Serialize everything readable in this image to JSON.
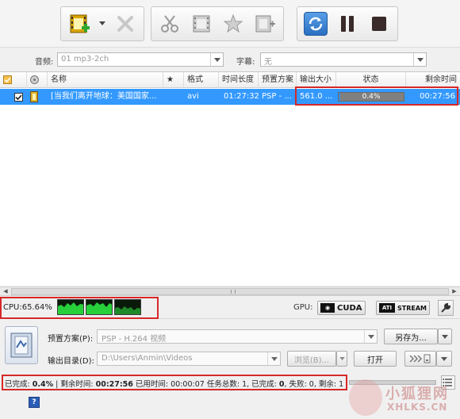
{
  "toolbar": {
    "icons": [
      "add-video-icon",
      "delete-icon",
      "cut-icon",
      "clip-icon",
      "effect-icon",
      "merge-icon",
      "convert-icon",
      "pause-icon",
      "stop-icon"
    ]
  },
  "options": {
    "audio_label": "音频:",
    "audio_value": "01 mp3-2ch",
    "subtitle_label": "字幕:",
    "subtitle_value": "无"
  },
  "columns": [
    "名称",
    "★",
    "格式",
    "时间长度",
    "预置方案",
    "输出大小",
    "状态",
    "剩余时间"
  ],
  "rows": [
    {
      "checked": true,
      "name": "[当我们离开地球：美国国家...",
      "format": "avi",
      "duration": "01:27:32",
      "preset": "PSP - ...",
      "output_size": "561.0 ...",
      "progress": 0.004,
      "progress_text": "0.4%",
      "remaining": "00:27:56"
    }
  ],
  "cpu": {
    "label": "CPU:65.64%",
    "gpu_label": "GPU:",
    "cuda": "CUDA",
    "stream": "STREAM",
    "ati": "ATI"
  },
  "settings": {
    "preset_label": "预置方案(P):",
    "preset_value": "PSP - H.264 视频",
    "save_as": "另存为...",
    "output_label": "输出目录(D):",
    "output_value": "D:\\Users\\Anmin\\Videos",
    "browse": "浏览(B)...",
    "open": "打开"
  },
  "status": {
    "completed_label": "已完成:",
    "completed_value": "0.4%",
    "remaining_label": "剩余时间:",
    "remaining_value": "00:27:56",
    "elapsed_label": "已用时间:",
    "elapsed_value": "00:00:07",
    "total_label": "任务总数:",
    "total_value": "1",
    "done_label": "已完成:",
    "done_value": "0",
    "failed_label": "失败:",
    "failed_value": "0",
    "left_label": "剩余:",
    "left_value": "1"
  },
  "help_label": "?",
  "watermark": {
    "cn": "小狐狸网",
    "en": "XHLKS.CN"
  },
  "colors": {
    "selection": "#3399ff",
    "highlight_box": "#d62828",
    "graph_line": "#27d03a"
  }
}
